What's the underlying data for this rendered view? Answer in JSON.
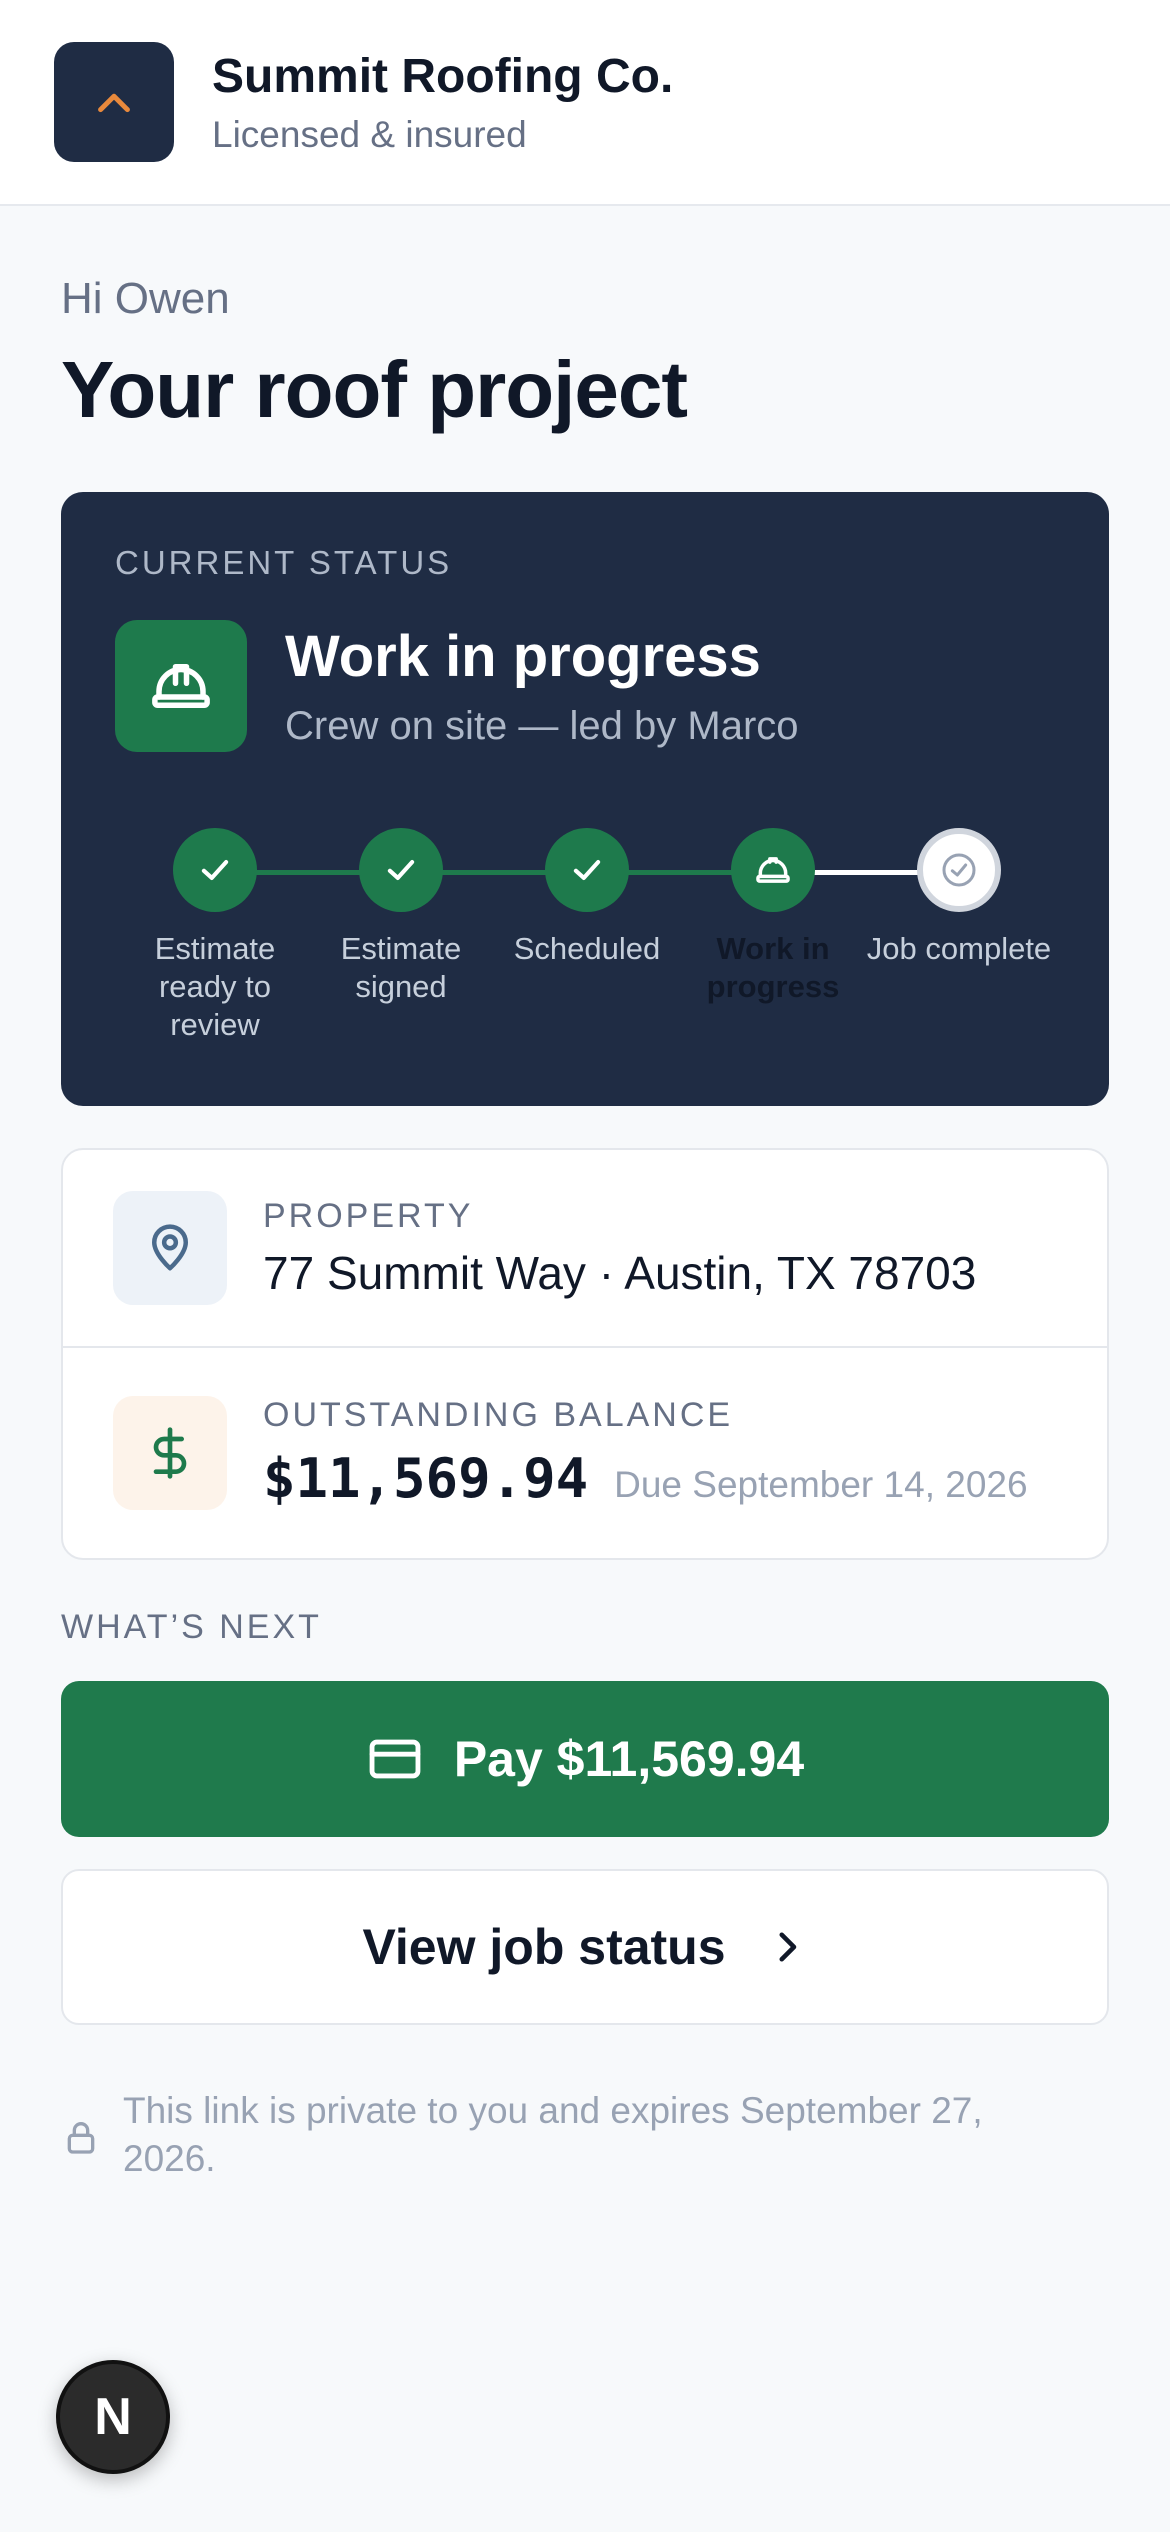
{
  "header": {
    "brand_name": "Summit Roofing Co.",
    "brand_sub": "Licensed & insured",
    "logo_icon": "chevron-up-icon",
    "accent": "#e8893c"
  },
  "greeting": "Hi Owen",
  "page_title": "Your roof project",
  "status": {
    "overline": "CURRENT STATUS",
    "title": "Work in progress",
    "subtitle": "Crew on site — led by Marco",
    "icon": "hard-hat-icon",
    "color": "#1e7a4c",
    "steps": [
      {
        "label": "Estimate ready to review",
        "state": "done"
      },
      {
        "label": "Estimate signed",
        "state": "done"
      },
      {
        "label": "Scheduled",
        "state": "done"
      },
      {
        "label": "Work in progress",
        "state": "current"
      },
      {
        "label": "Job complete",
        "state": "upcoming"
      }
    ]
  },
  "property": {
    "overline": "PROPERTY",
    "address": "77 Summit Way · Austin, TX 78703",
    "icon": "map-pin-icon"
  },
  "balance": {
    "overline": "OUTSTANDING BALANCE",
    "amount": "$11,569.94",
    "due": "Due September 14, 2026",
    "icon": "dollar-icon"
  },
  "next": {
    "label": "WHAT’S NEXT",
    "pay_label": "Pay $11,569.94",
    "view_label": "View job status"
  },
  "privacy_text": "This link is private to you and expires September 27, 2026.",
  "fab_label": "N"
}
